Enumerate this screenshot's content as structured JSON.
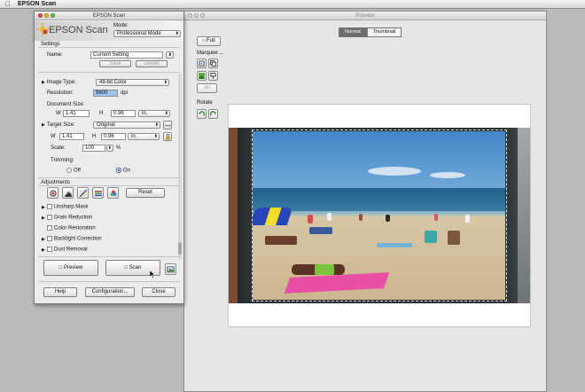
{
  "menubar": {
    "app_name": "EPSON Scan"
  },
  "preview": {
    "title": "Preview",
    "tabs": [
      {
        "label": "Normal",
        "active": true
      },
      {
        "label": "Thumbnail",
        "active": false
      }
    ],
    "full_label": "Full",
    "marquee_label": "Marquee ...",
    "all_label": "All",
    "rotate_label": "Rotate"
  },
  "scan": {
    "title": "EPSON Scan",
    "logo": "EPSON Scan",
    "mode_label": "Mode:",
    "mode_value": "Professional Mode",
    "settings_header": "Settings",
    "name_label": "Name:",
    "name_value": "Current Setting",
    "save_label": "Save",
    "delete_label": "Delete",
    "image_type_label": "Image Type:",
    "image_type_value": "48-bit Color",
    "resolution_label": "Resolution:",
    "resolution_value": "9600",
    "resolution_unit": "dpi",
    "doc_size_label": "Document Size:",
    "doc_w_label": "W",
    "doc_w_value": "1.41",
    "doc_h_label": "H",
    "doc_h_value": "0.96",
    "doc_unit": "in.",
    "target_size_label": "Target Size:",
    "target_size_value": "Original",
    "tgt_w_label": "W",
    "tgt_w_value": "1.41",
    "tgt_h_label": "H",
    "tgt_h_value": "0.96",
    "tgt_unit": "in.",
    "scale_label": "Scale:",
    "scale_value": "100",
    "scale_unit": "%",
    "trimming_label": "Trimming:",
    "trim_off": "Off",
    "trim_on": "On",
    "adjustments_header": "Adjustments",
    "reset_label": "Reset",
    "options": [
      "Unsharp Mask",
      "Grain Reduction",
      "Color Restoration",
      "Backlight Correction",
      "Dust Removal"
    ],
    "preview_button": "Preview",
    "scan_button": "Scan",
    "help_button": "Help",
    "config_button": "Configuration...",
    "close_button": "Close"
  }
}
